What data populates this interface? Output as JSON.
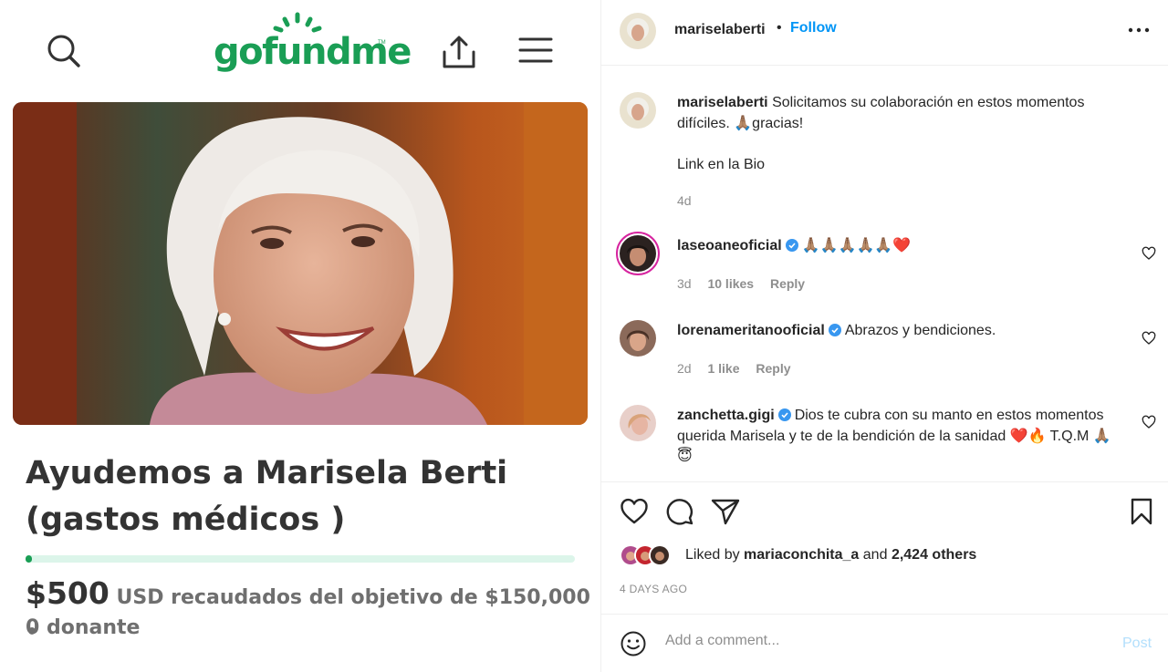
{
  "gofundme": {
    "logo": "gofundme",
    "campaign_title": "Ayudemos a Marisela Berti (gastos médicos )",
    "amount_raised": "$500",
    "raised_text": "USD recaudados del objetivo de $150,000 •",
    "donors": "0 donante",
    "progress_fraction": 0.0033,
    "brand_color": "#1a9e55",
    "icons": [
      "search-icon",
      "share-icon",
      "hamburger-menu-icon"
    ]
  },
  "post": {
    "author": "mariselaberti",
    "follow_label": "Follow",
    "caption_text": "Solicitamos su colaboración en estos momentos difíciles. 🙏🏽gracias!",
    "caption_line2": "Link en la Bio",
    "caption_age": "4d"
  },
  "comments": [
    {
      "username": "laseoaneoficial",
      "verified": true,
      "text": "🙏🏽🙏🏽🙏🏽🙏🏽🙏🏽❤️",
      "age": "3d",
      "likes": "10 likes",
      "reply": "Reply"
    },
    {
      "username": "lorenameritanooficial",
      "verified": true,
      "text": "Abrazos y bendiciones.",
      "age": "2d",
      "likes": "1 like",
      "reply": "Reply"
    },
    {
      "username": "zanchetta.gigi",
      "verified": true,
      "text": "Dios te cubra con su manto en estos momentos querida Marisela y te de la bendición de la sanidad ❤️🔥 T.Q.M 🙏🏽😇"
    }
  ],
  "likes": {
    "prefix": "Liked by",
    "first_user": "mariaconchita_a",
    "and": "and",
    "others": "2,424 others"
  },
  "post_date": "4 DAYS AGO",
  "comment_box": {
    "placeholder": "Add a comment...",
    "post_label": "Post"
  },
  "colors": {
    "link_blue": "#0095f6",
    "post_disabled": "#b2dffc",
    "muted": "#8e8e8e"
  }
}
